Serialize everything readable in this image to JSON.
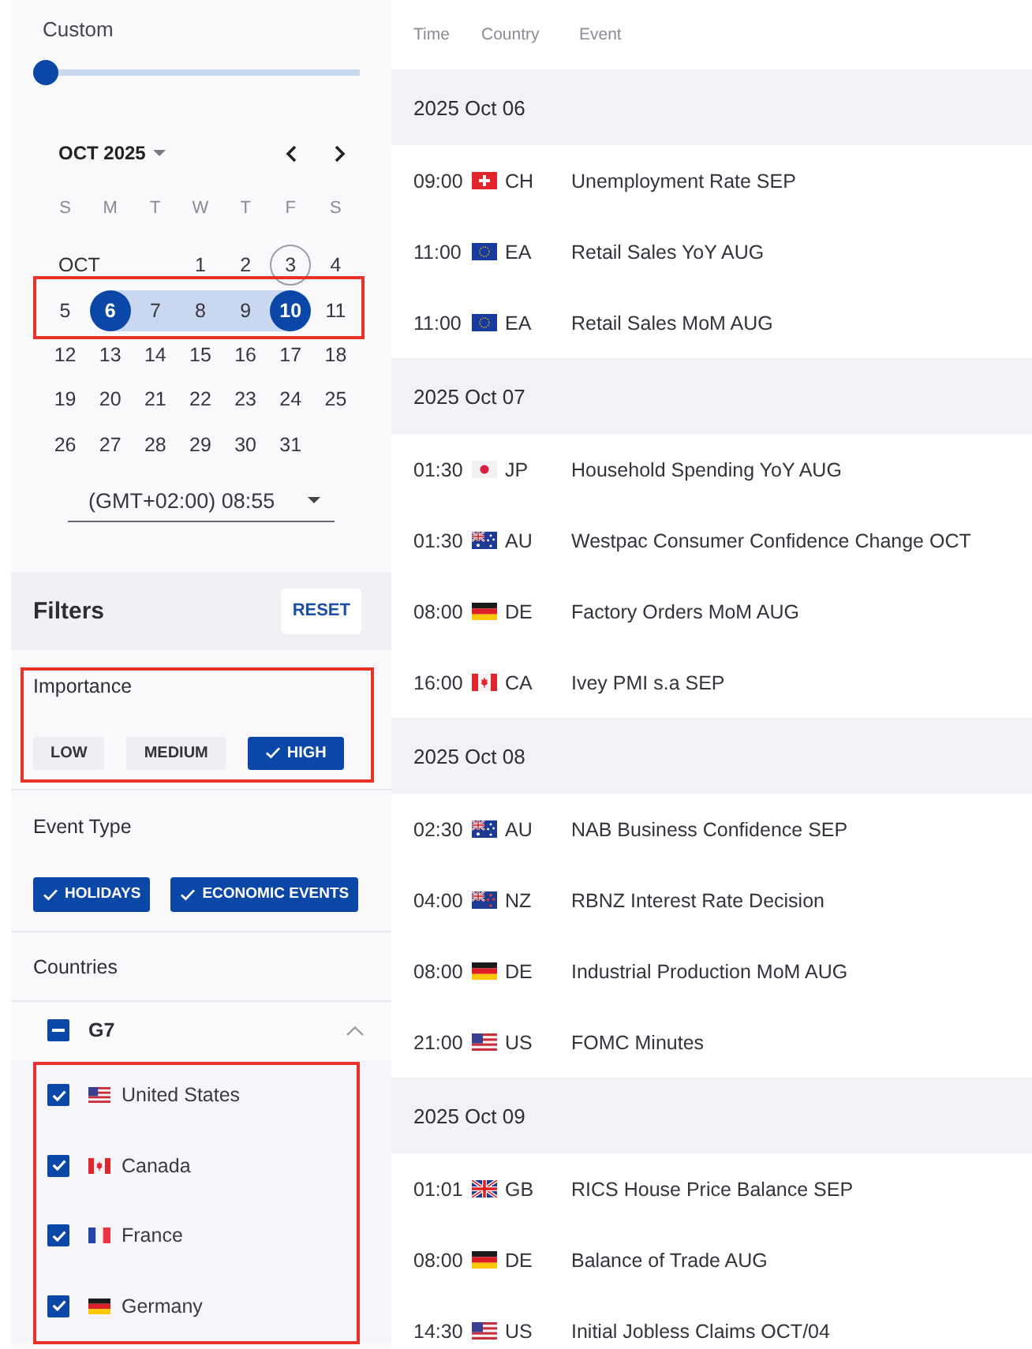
{
  "slider": {
    "label": "Custom",
    "level": 0
  },
  "calendar": {
    "month": "OCT 2025",
    "weekdays": [
      "S",
      "M",
      "T",
      "W",
      "T",
      "F",
      "S"
    ],
    "weeks": [
      {
        "highlighted": false,
        "cells": [
          {
            "kind": "month",
            "text": "OCT"
          },
          {
            "kind": "empty"
          },
          {
            "kind": "day",
            "text": "1",
            "selected": false
          },
          {
            "kind": "day",
            "text": "2",
            "selected": false
          },
          {
            "kind": "today",
            "text": "3",
            "selected": false
          },
          {
            "kind": "day",
            "text": "4",
            "selected": false
          }
        ]
      },
      {
        "highlighted": true,
        "cells": [
          {
            "kind": "day",
            "text": "5",
            "selected": false
          },
          {
            "kind": "day",
            "text": "6",
            "selected": true
          },
          {
            "kind": "day",
            "text": "7",
            "selected": false
          },
          {
            "kind": "day",
            "text": "8",
            "selected": false
          },
          {
            "kind": "day",
            "text": "9",
            "selected": false
          },
          {
            "kind": "day",
            "text": "10",
            "selected": true
          },
          {
            "kind": "day",
            "text": "11",
            "selected": false
          }
        ]
      },
      {
        "highlighted": false,
        "cells": [
          {
            "kind": "day",
            "text": "12",
            "selected": false
          },
          {
            "kind": "day",
            "text": "13",
            "selected": false
          },
          {
            "kind": "day",
            "text": "14",
            "selected": false
          },
          {
            "kind": "day",
            "text": "15",
            "selected": false
          },
          {
            "kind": "day",
            "text": "16",
            "selected": false
          },
          {
            "kind": "day",
            "text": "17",
            "selected": false
          },
          {
            "kind": "day",
            "text": "18",
            "selected": false
          }
        ]
      },
      {
        "highlighted": false,
        "cells": [
          {
            "kind": "day",
            "text": "19",
            "selected": false
          },
          {
            "kind": "day",
            "text": "20",
            "selected": false
          },
          {
            "kind": "day",
            "text": "21",
            "selected": false
          },
          {
            "kind": "day",
            "text": "22",
            "selected": false
          },
          {
            "kind": "day",
            "text": "23",
            "selected": false
          },
          {
            "kind": "day",
            "text": "24",
            "selected": false
          },
          {
            "kind": "day",
            "text": "25",
            "selected": false
          }
        ]
      },
      {
        "highlighted": false,
        "cells": [
          {
            "kind": "day",
            "text": "26",
            "selected": false
          },
          {
            "kind": "day",
            "text": "27",
            "selected": false
          },
          {
            "kind": "day",
            "text": "28",
            "selected": false
          },
          {
            "kind": "day",
            "text": "29",
            "selected": false
          },
          {
            "kind": "day",
            "text": "30",
            "selected": false
          },
          {
            "kind": "day",
            "text": "31",
            "selected": false
          }
        ]
      }
    ]
  },
  "timezone": {
    "value": "(GMT+02:00) 08:55"
  },
  "filters": {
    "title": "Filters",
    "reset": "RESET"
  },
  "importance": {
    "label": "Importance",
    "highlighted": true,
    "options": [
      {
        "label": "LOW",
        "selected": false
      },
      {
        "label": "MEDIUM",
        "selected": false
      },
      {
        "label": "HIGH",
        "selected": true
      }
    ]
  },
  "event_type": {
    "label": "Event Type",
    "options": [
      {
        "label": "HOLIDAYS",
        "selected": true
      },
      {
        "label": "ECONOMIC EVENTS",
        "selected": true
      }
    ]
  },
  "countries": {
    "label": "Countries",
    "group": {
      "label": "G7",
      "indeterminate": true,
      "expanded": true
    },
    "highlighted": true,
    "items": [
      {
        "name": "United States",
        "kind": "usa",
        "checked": true
      },
      {
        "name": "Canada",
        "kind": "canada",
        "checked": true
      },
      {
        "name": "France",
        "kind": "france",
        "checked": true
      },
      {
        "name": "Germany",
        "kind": "germany",
        "checked": true
      }
    ]
  },
  "table": {
    "columns": [
      "Time",
      "Country",
      "Event"
    ],
    "groups": [
      {
        "date": "2025 Oct 06",
        "rows": [
          {
            "time": "09:00",
            "kind": "switzerland",
            "code": "CH",
            "event": "Unemployment Rate SEP"
          },
          {
            "time": "11:00",
            "kind": "eu",
            "code": "EA",
            "event": "Retail Sales YoY AUG"
          },
          {
            "time": "11:00",
            "kind": "eu",
            "code": "EA",
            "event": "Retail Sales MoM AUG"
          }
        ]
      },
      {
        "date": "2025 Oct 07",
        "rows": [
          {
            "time": "01:30",
            "kind": "japan",
            "code": "JP",
            "event": "Household Spending YoY AUG"
          },
          {
            "time": "01:30",
            "kind": "australia",
            "code": "AU",
            "event": "Westpac Consumer Confidence Change OCT"
          },
          {
            "time": "08:00",
            "kind": "germany",
            "code": "DE",
            "event": "Factory Orders MoM AUG"
          },
          {
            "time": "16:00",
            "kind": "canada",
            "code": "CA",
            "event": "Ivey PMI s.a SEP"
          }
        ]
      },
      {
        "date": "2025 Oct 08",
        "rows": [
          {
            "time": "02:30",
            "kind": "australia",
            "code": "AU",
            "event": "NAB Business Confidence SEP"
          },
          {
            "time": "04:00",
            "kind": "newzealand",
            "code": "NZ",
            "event": "RBNZ Interest Rate Decision"
          },
          {
            "time": "08:00",
            "kind": "germany",
            "code": "DE",
            "event": "Industrial Production MoM AUG"
          },
          {
            "time": "21:00",
            "kind": "usa",
            "code": "US",
            "event": "FOMC Minutes"
          }
        ]
      },
      {
        "date": "2025 Oct 09",
        "rows": [
          {
            "time": "01:01",
            "kind": "uk",
            "code": "GB",
            "event": "RICS House Price Balance SEP"
          },
          {
            "time": "08:00",
            "kind": "germany",
            "code": "DE",
            "event": "Balance of Trade AUG"
          },
          {
            "time": "14:30",
            "kind": "usa",
            "code": "US",
            "event": "Initial Jobless Claims OCT/04"
          }
        ]
      }
    ]
  }
}
